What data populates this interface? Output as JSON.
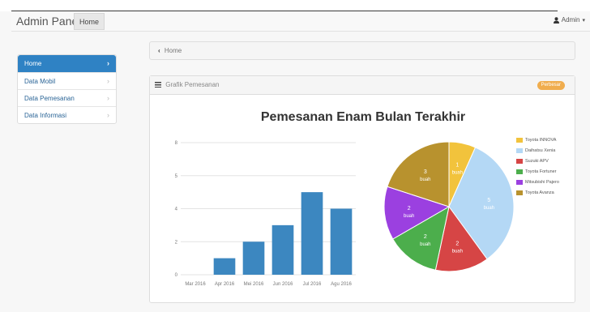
{
  "navbar": {
    "brand": "Admin Panel",
    "home_label": "Home",
    "user_label": "Admin",
    "user_icon": "user-icon",
    "caret_icon": "caret-down-icon"
  },
  "sidebar": {
    "items": [
      {
        "label": "Home",
        "active": true
      },
      {
        "label": "Data Mobil",
        "active": false
      },
      {
        "label": "Data Pemesanan",
        "active": false
      },
      {
        "label": "Data Informasi",
        "active": false
      }
    ],
    "chevron_icon": "chevron-right-icon"
  },
  "breadcrumb": {
    "back_icon": "chevron-left-icon",
    "label": "Home"
  },
  "panel": {
    "title": "Grafik Pemesanan",
    "title_icon": "bar-chart-icon",
    "badge": "Perbesar",
    "badge_color": "#f0ad4e"
  },
  "chart_data": [
    {
      "type": "bar",
      "title": "Pemesanan Enam Bulan Terakhir",
      "categories": [
        "Mar 2016",
        "Apr 2016",
        "Mei 2016",
        "Jun 2016",
        "Jul 2016",
        "Agu 2016"
      ],
      "values": [
        0,
        1,
        2,
        3,
        5,
        4
      ],
      "ylim": [
        0,
        8
      ],
      "yticks": [
        "0",
        "2",
        "4",
        "5",
        "8"
      ],
      "ytick_values": [
        0,
        2,
        4,
        6,
        8
      ],
      "grid": true,
      "color": "#3c87c0"
    },
    {
      "type": "pie",
      "labels": [
        "Toyota INNOVA",
        "Daihatsu Xenia",
        "Suzuki APV",
        "Toyota Fortuner",
        "Mitsubishi Pajero",
        "Toyota Avanza"
      ],
      "values": [
        1,
        5,
        2,
        2,
        2,
        3
      ],
      "slice_labels": [
        [
          "1",
          "buah"
        ],
        [
          "5",
          "buah"
        ],
        [
          "2",
          "buah"
        ],
        [
          "2",
          "buah"
        ],
        [
          "2",
          "buah"
        ],
        [
          "3",
          "buah"
        ]
      ],
      "colors": [
        "#f2c33c",
        "#b4d8f5",
        "#d64545",
        "#4cae4c",
        "#9b40e0",
        "#b8922e"
      ],
      "legend": "right"
    }
  ]
}
